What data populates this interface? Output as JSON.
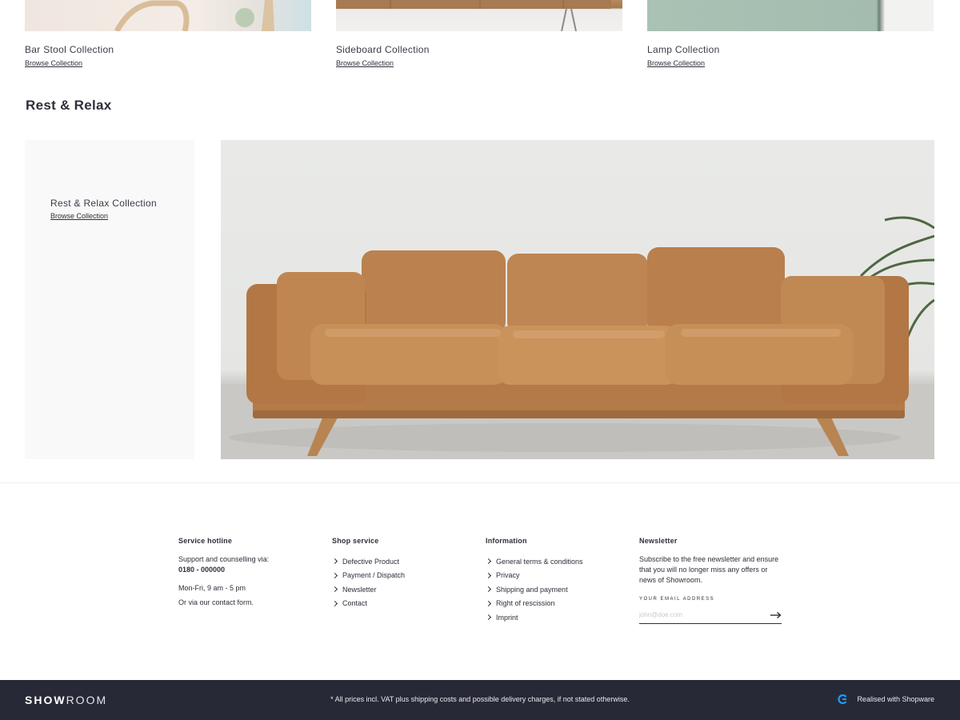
{
  "collections": [
    {
      "name": "Bar Stool Collection",
      "link": "Browse Collection"
    },
    {
      "name": "Sideboard Collection",
      "link": "Browse Collection"
    },
    {
      "name": "Lamp Collection",
      "link": "Browse Collection"
    }
  ],
  "section": {
    "title": "Rest & Relax",
    "card_name": "Rest & Relax Collection",
    "card_link": "Browse Collection"
  },
  "footer": {
    "hotline": {
      "title": "Service hotline",
      "line1": "Support and counselling via:",
      "phone": "0180 - 000000",
      "hours": "Mon-Fri, 9 am - 5 pm",
      "contact": "Or via our contact form."
    },
    "shop_service": {
      "title": "Shop service",
      "items": [
        "Defective Product",
        "Payment / Dispatch",
        "Newsletter",
        "Contact"
      ]
    },
    "information": {
      "title": "Information",
      "items": [
        "General terms & conditions",
        "Privacy",
        "Shipping and payment",
        "Right of rescission",
        "Imprint"
      ]
    },
    "newsletter": {
      "title": "Newsletter",
      "text": "Subscribe to the free newsletter and ensure that you will no longer miss any offers or news of Showroom.",
      "label": "YOUR EMAIL ADDRESS",
      "placeholder": "john@doe.com"
    }
  },
  "bottombar": {
    "logo_bold": "SHOW",
    "logo_light": "ROOM",
    "vat_notice": "* All prices incl. VAT plus shipping costs and possible delivery charges, if not stated otherwise.",
    "realised": "Realised with Shopware"
  },
  "colors": {
    "dark": "#282936",
    "text": "#2d2f3a",
    "card_bg": "#f9f9f9",
    "shopware_blue": "#189eff"
  }
}
